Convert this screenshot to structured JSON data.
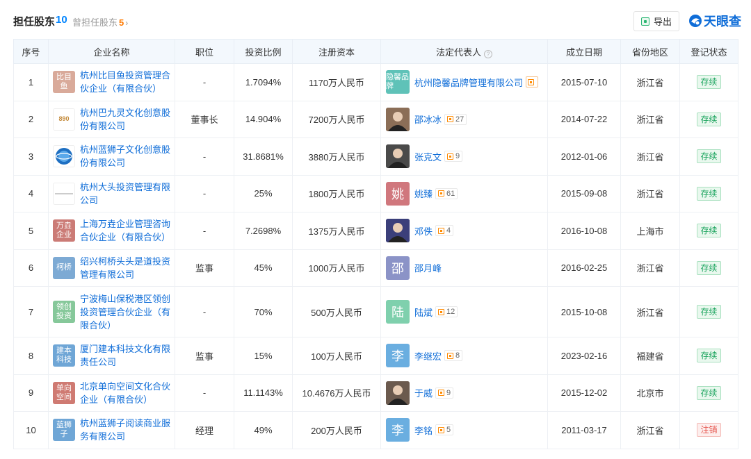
{
  "header": {
    "title": "担任股东",
    "count": "10",
    "former_label": "曾担任股东",
    "former_count": "5",
    "former_chevron": "›",
    "export_label": "导出",
    "brand": "天眼查"
  },
  "columns": [
    "序号",
    "企业名称",
    "职位",
    "投资比例",
    "注册资本",
    "法定代表人",
    "成立日期",
    "省份地区",
    "登记状态"
  ],
  "colors": {
    "link": "#0f6dd8",
    "accent": "#0084ff",
    "live": "#19a35c",
    "dead": "#e5534b",
    "header_bg": "#f3f8fd"
  },
  "rows": [
    {
      "no": "1",
      "company": "杭州比目鱼投资管理合伙企业（有限合伙）",
      "logo_text": "比目鱼",
      "logo_color": "#d9aa9a",
      "position": "-",
      "ratio": "1.7094%",
      "capital": "1170万人民币",
      "rep": "杭州隐馨品牌管理有限公司",
      "rep_avatar_text": "隐馨品牌",
      "rep_avatar_color": "#5fc2b8",
      "rep_count": "",
      "rep_badge_icon": "company-tag-icon",
      "date": "2015-07-10",
      "province": "浙江省",
      "status": "存续"
    },
    {
      "no": "2",
      "company": "杭州巴九灵文化创意股份有限公司",
      "logo_text": "890",
      "logo_color": "#ffffff",
      "position": "董事长",
      "ratio": "14.904%",
      "capital": "7200万人民币",
      "rep": "邵冰冰",
      "rep_avatar_text": "",
      "rep_avatar_color": "#8b6e57",
      "rep_count": "27",
      "date": "2014-07-22",
      "province": "浙江省",
      "status": "存续"
    },
    {
      "no": "3",
      "company": "杭州蓝狮子文化创意股份有限公司",
      "logo_text": "",
      "logo_color": "#ffffff",
      "position": "-",
      "ratio": "31.8681%",
      "capital": "3880万人民币",
      "rep": "张克文",
      "rep_avatar_text": "",
      "rep_avatar_color": "#4a4a4a",
      "rep_count": "9",
      "date": "2012-01-06",
      "province": "浙江省",
      "status": "存续"
    },
    {
      "no": "4",
      "company": "杭州大头投资管理有限公司",
      "logo_text": "",
      "logo_color": "#ffffff",
      "position": "-",
      "ratio": "25%",
      "capital": "1800万人民币",
      "rep": "姚臻",
      "rep_avatar_text": "姚",
      "rep_avatar_color": "#d0777d",
      "rep_count": "61",
      "date": "2015-09-08",
      "province": "浙江省",
      "status": "存续"
    },
    {
      "no": "5",
      "company": "上海万垚企业管理咨询合伙企业（有限合伙）",
      "logo_text": "万垚企业",
      "logo_color": "#cb7b76",
      "position": "-",
      "ratio": "7.2698%",
      "capital": "1375万人民币",
      "rep": "邓佚",
      "rep_avatar_text": "",
      "rep_avatar_color": "#3b3f7a",
      "rep_count": "4",
      "date": "2016-10-08",
      "province": "上海市",
      "status": "存续"
    },
    {
      "no": "6",
      "company": "绍兴柯桥头头是道投资管理有限公司",
      "logo_text": "柯桥",
      "logo_color": "#7daad4",
      "position": "监事",
      "ratio": "45%",
      "capital": "1000万人民币",
      "rep": "邵月峰",
      "rep_avatar_text": "邵",
      "rep_avatar_color": "#8b93c7",
      "rep_count": "",
      "date": "2016-02-25",
      "province": "浙江省",
      "status": "存续"
    },
    {
      "no": "7",
      "company": "宁波梅山保税港区领创投资管理合伙企业（有限合伙）",
      "logo_text": "领创投资",
      "logo_color": "#86c89a",
      "position": "-",
      "ratio": "70%",
      "capital": "500万人民币",
      "rep": "陆斌",
      "rep_avatar_text": "陆",
      "rep_avatar_color": "#7fd0ad",
      "rep_count": "12",
      "date": "2015-10-08",
      "province": "浙江省",
      "status": "存续"
    },
    {
      "no": "8",
      "company": "厦门建本科技文化有限责任公司",
      "logo_text": "建本科技",
      "logo_color": "#6fa6d6",
      "position": "监事",
      "ratio": "15%",
      "capital": "100万人民币",
      "rep": "李继宏",
      "rep_avatar_text": "李",
      "rep_avatar_color": "#6aaee0",
      "rep_count": "8",
      "date": "2023-02-16",
      "province": "福建省",
      "status": "存续"
    },
    {
      "no": "9",
      "company": "北京单向空间文化合伙企业（有限合伙）",
      "logo_text": "单向空间",
      "logo_color": "#cf7a72",
      "position": "-",
      "ratio": "11.1143%",
      "capital": "10.4676万人民币",
      "rep": "于威",
      "rep_avatar_text": "",
      "rep_avatar_color": "#6b5a4e",
      "rep_count": "9",
      "date": "2015-12-02",
      "province": "北京市",
      "status": "存续"
    },
    {
      "no": "10",
      "company": "杭州蓝狮子阅读商业服务有限公司",
      "logo_text": "蓝狮子",
      "logo_color": "#6fa6d6",
      "position": "经理",
      "ratio": "49%",
      "capital": "200万人民币",
      "rep": "李铭",
      "rep_avatar_text": "李",
      "rep_avatar_color": "#6aaee0",
      "rep_count": "5",
      "date": "2011-03-17",
      "province": "浙江省",
      "status": "注销"
    }
  ]
}
